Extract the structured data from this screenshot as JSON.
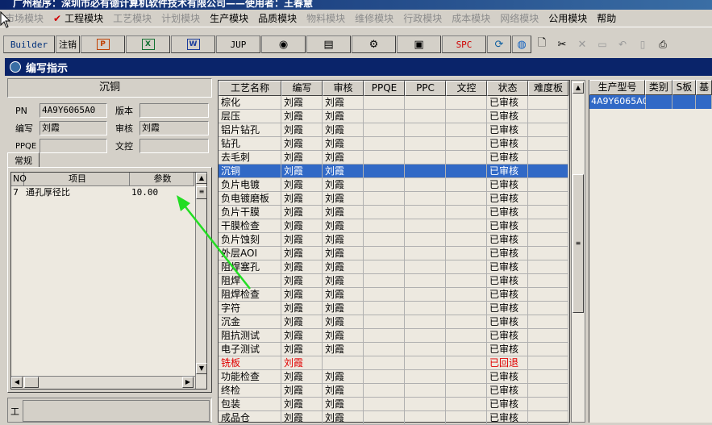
{
  "titlebar": {
    "text": "广州程序：深圳市必有德计算机软件技术有限公司——使用者：王春慧"
  },
  "menu": {
    "items": [
      {
        "label": "市场模块",
        "active": false
      },
      {
        "label": "工程模块",
        "active": true
      },
      {
        "label": "工艺模块",
        "active": false
      },
      {
        "label": "计划模块",
        "active": false
      },
      {
        "label": "生产模块",
        "active": true
      },
      {
        "label": "品质模块",
        "active": true
      },
      {
        "label": "物料模块",
        "active": false
      },
      {
        "label": "维修模块",
        "active": false
      },
      {
        "label": "行政模块",
        "active": false
      },
      {
        "label": "成本模块",
        "active": false
      },
      {
        "label": "网络模块",
        "active": false
      },
      {
        "label": "公用模块",
        "active": true
      },
      {
        "label": "帮助",
        "active": true
      }
    ]
  },
  "toolbar": {
    "builder_label": "Builder",
    "logout_label": "注销",
    "jup_label": "JUP",
    "spc_label": "SPC",
    "icons": [
      "ppt-icon",
      "excel-icon",
      "word-icon",
      "jup-icon",
      "eye-icon",
      "database-icon",
      "network-icon",
      "computer-icon",
      "spc-icon",
      "refresh-icon",
      "globe-icon",
      "new-icon",
      "cut-icon",
      "delete-icon",
      "save-icon",
      "undo-icon",
      "preview-icon",
      "print-icon"
    ]
  },
  "window": {
    "title": "编写指示"
  },
  "left": {
    "section_title": "沉铜",
    "fields": {
      "pn_label": "PN",
      "pn_value": "4A9Y6065A0",
      "version_label": "版本",
      "version_value": "",
      "writer_label": "编写",
      "writer_value": "刘霞",
      "reviewer_label": "审核",
      "reviewer_value": "刘霞",
      "ppqe_label": "PPQE",
      "ppqe_value": "",
      "doc_label": "文控",
      "doc_value": ""
    },
    "tab_label": "常规",
    "subgrid": {
      "headers": [
        "NO",
        "项目",
        "参数"
      ],
      "rows": [
        [
          "7",
          "通孔厚径比",
          "10.00"
        ]
      ]
    },
    "bottom_label": "工"
  },
  "main_grid": {
    "headers": [
      "工艺名称",
      "编写",
      "审核",
      "PPQE",
      "PPC",
      "文控",
      "状态",
      "难度板"
    ],
    "rows": [
      [
        "棕化",
        "刘霞",
        "刘霞",
        "",
        "",
        "",
        "已审核",
        ""
      ],
      [
        "层压",
        "刘霞",
        "刘霞",
        "",
        "",
        "",
        "已审核",
        ""
      ],
      [
        "铝片钻孔",
        "刘霞",
        "刘霞",
        "",
        "",
        "",
        "已审核",
        ""
      ],
      [
        "钻孔",
        "刘霞",
        "刘霞",
        "",
        "",
        "",
        "已审核",
        ""
      ],
      [
        "去毛刺",
        "刘霞",
        "刘霞",
        "",
        "",
        "",
        "已审核",
        ""
      ],
      [
        "沉铜",
        "刘霞",
        "刘霞",
        "",
        "",
        "",
        "已审核",
        ""
      ],
      [
        "负片电镀",
        "刘霞",
        "刘霞",
        "",
        "",
        "",
        "已审核",
        ""
      ],
      [
        "负电镀磨板",
        "刘霞",
        "刘霞",
        "",
        "",
        "",
        "已审核",
        ""
      ],
      [
        "负片干膜",
        "刘霞",
        "刘霞",
        "",
        "",
        "",
        "已审核",
        ""
      ],
      [
        "干膜检查",
        "刘霞",
        "刘霞",
        "",
        "",
        "",
        "已审核",
        ""
      ],
      [
        "负片蚀刻",
        "刘霞",
        "刘霞",
        "",
        "",
        "",
        "已审核",
        ""
      ],
      [
        "外层AOI",
        "刘霞",
        "刘霞",
        "",
        "",
        "",
        "已审核",
        ""
      ],
      [
        "阻焊塞孔",
        "刘霞",
        "刘霞",
        "",
        "",
        "",
        "已审核",
        ""
      ],
      [
        "阻焊",
        "刘霞",
        "刘霞",
        "",
        "",
        "",
        "已审核",
        ""
      ],
      [
        "阻焊检查",
        "刘霞",
        "刘霞",
        "",
        "",
        "",
        "已审核",
        ""
      ],
      [
        "字符",
        "刘霞",
        "刘霞",
        "",
        "",
        "",
        "已审核",
        ""
      ],
      [
        "沉金",
        "刘霞",
        "刘霞",
        "",
        "",
        "",
        "已审核",
        ""
      ],
      [
        "阻抗测试",
        "刘霞",
        "刘霞",
        "",
        "",
        "",
        "已审核",
        ""
      ],
      [
        "电子测试",
        "刘霞",
        "刘霞",
        "",
        "",
        "",
        "已审核",
        ""
      ],
      [
        "铣板",
        "刘霞",
        "",
        "",
        "",
        "",
        "已回退",
        ""
      ],
      [
        "功能检查",
        "刘霞",
        "刘霞",
        "",
        "",
        "",
        "已审核",
        ""
      ],
      [
        "终检",
        "刘霞",
        "刘霞",
        "",
        "",
        "",
        "已审核",
        ""
      ],
      [
        "包装",
        "刘霞",
        "刘霞",
        "",
        "",
        "",
        "已审核",
        ""
      ],
      [
        "成品仓",
        "刘霞",
        "刘霞",
        "",
        "",
        "",
        "已审核",
        ""
      ]
    ],
    "selected_index": 5,
    "returned_index": 19
  },
  "right_grid": {
    "headers": [
      "生产型号",
      "类别",
      "S板",
      "基"
    ],
    "rows": [
      [
        "4A9Y6065A0",
        "",
        "",
        ""
      ]
    ]
  },
  "colors": {
    "selection": "#3169c6",
    "returned_text": "#e00000",
    "arrow": "#22dd22"
  }
}
